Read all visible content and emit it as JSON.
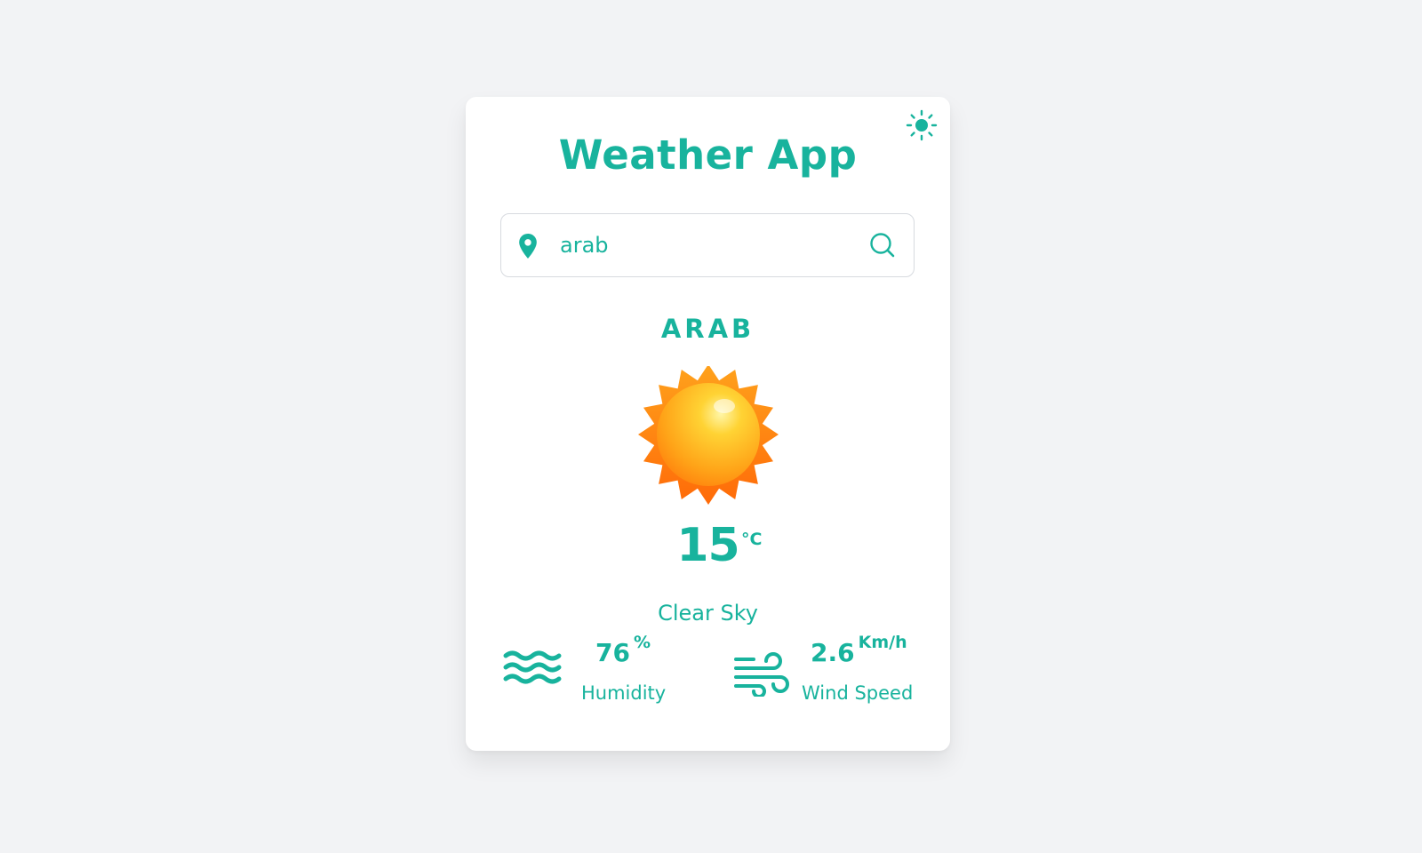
{
  "app": {
    "title": "Weather App",
    "accent_color": "#18b39d",
    "background_color": "#f2f3f5",
    "theme_toggle_icon": "sun-icon"
  },
  "search": {
    "value": "arab",
    "location_icon": "location-pin-icon",
    "search_icon": "magnifier-icon"
  },
  "weather": {
    "city": "ARAB",
    "icon": "sun-weather-icon",
    "temperature": "15",
    "temperature_unit": "°C",
    "description": "Clear Sky"
  },
  "stats": {
    "humidity": {
      "value": "76",
      "unit": "%",
      "label": "Humidity",
      "icon": "waves-icon"
    },
    "wind": {
      "value": "2.6",
      "unit": "Km/h",
      "label": "Wind Speed",
      "icon": "wind-icon"
    }
  }
}
